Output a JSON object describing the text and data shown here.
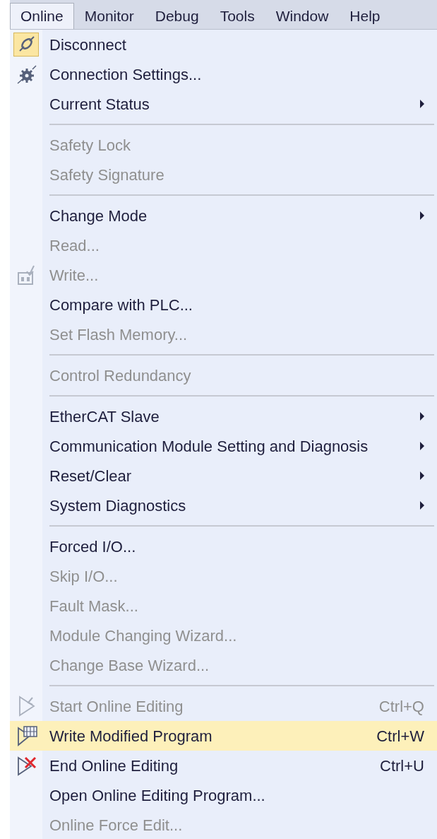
{
  "menubar": [
    {
      "label": "Online",
      "selected": true
    },
    {
      "label": "Monitor",
      "selected": false
    },
    {
      "label": "Debug",
      "selected": false
    },
    {
      "label": "Tools",
      "selected": false
    },
    {
      "label": "Window",
      "selected": false
    },
    {
      "label": "Help",
      "selected": false
    }
  ],
  "menu": {
    "groups": [
      [
        {
          "label": "Disconnect",
          "disabled": false,
          "submenu": false,
          "checked": true,
          "selected": false
        },
        {
          "label": "Connection Settings...",
          "disabled": false,
          "submenu": false,
          "checked": false,
          "selected": false
        },
        {
          "label": "Current Status",
          "disabled": false,
          "submenu": true,
          "checked": false,
          "selected": false
        }
      ],
      [
        {
          "label": "Safety Lock",
          "disabled": true,
          "submenu": false,
          "checked": false,
          "selected": false
        },
        {
          "label": "Safety Signature",
          "disabled": true,
          "submenu": false,
          "checked": false,
          "selected": false
        }
      ],
      [
        {
          "label": "Change Mode",
          "disabled": false,
          "submenu": true,
          "checked": false,
          "selected": false
        },
        {
          "label": "Read...",
          "disabled": true,
          "submenu": false,
          "checked": false,
          "selected": false
        },
        {
          "label": "Write...",
          "disabled": true,
          "submenu": false,
          "checked": false,
          "selected": false
        },
        {
          "label": "Compare with PLC...",
          "disabled": false,
          "submenu": false,
          "checked": false,
          "selected": false
        },
        {
          "label": "Set Flash Memory...",
          "disabled": true,
          "submenu": false,
          "checked": false,
          "selected": false
        }
      ],
      [
        {
          "label": "Control Redundancy",
          "disabled": true,
          "submenu": false,
          "checked": false,
          "selected": false
        }
      ],
      [
        {
          "label": "EtherCAT Slave",
          "disabled": false,
          "submenu": true,
          "checked": false,
          "selected": false
        },
        {
          "label": "Communication Module Setting and Diagnosis",
          "disabled": false,
          "submenu": true,
          "checked": false,
          "selected": false
        },
        {
          "label": "Reset/Clear",
          "disabled": false,
          "submenu": true,
          "checked": false,
          "selected": false
        },
        {
          "label": "System Diagnostics",
          "disabled": false,
          "submenu": true,
          "checked": false,
          "selected": false
        }
      ],
      [
        {
          "label": "Forced I/O...",
          "disabled": false,
          "submenu": false,
          "checked": false,
          "selected": false
        },
        {
          "label": "Skip I/O...",
          "disabled": true,
          "submenu": false,
          "checked": false,
          "selected": false
        },
        {
          "label": "Fault Mask...",
          "disabled": true,
          "submenu": false,
          "checked": false,
          "selected": false
        },
        {
          "label": "Module Changing Wizard...",
          "disabled": true,
          "submenu": false,
          "checked": false,
          "selected": false
        },
        {
          "label": "Change Base Wizard...",
          "disabled": true,
          "submenu": false,
          "checked": false,
          "selected": false
        }
      ],
      [
        {
          "label": "Start Online Editing",
          "shortcut": "Ctrl+Q",
          "disabled": true,
          "submenu": false,
          "checked": false,
          "selected": false
        },
        {
          "label": "Write Modified Program",
          "shortcut": "Ctrl+W",
          "disabled": false,
          "submenu": false,
          "checked": false,
          "selected": true
        },
        {
          "label": "End Online Editing",
          "shortcut": "Ctrl+U",
          "disabled": false,
          "submenu": false,
          "checked": false,
          "selected": false
        },
        {
          "label": "Open Online Editing Program...",
          "disabled": false,
          "submenu": false,
          "checked": false,
          "selected": false
        },
        {
          "label": "Online Force Edit...",
          "disabled": true,
          "submenu": false,
          "checked": false,
          "selected": false
        }
      ]
    ]
  }
}
